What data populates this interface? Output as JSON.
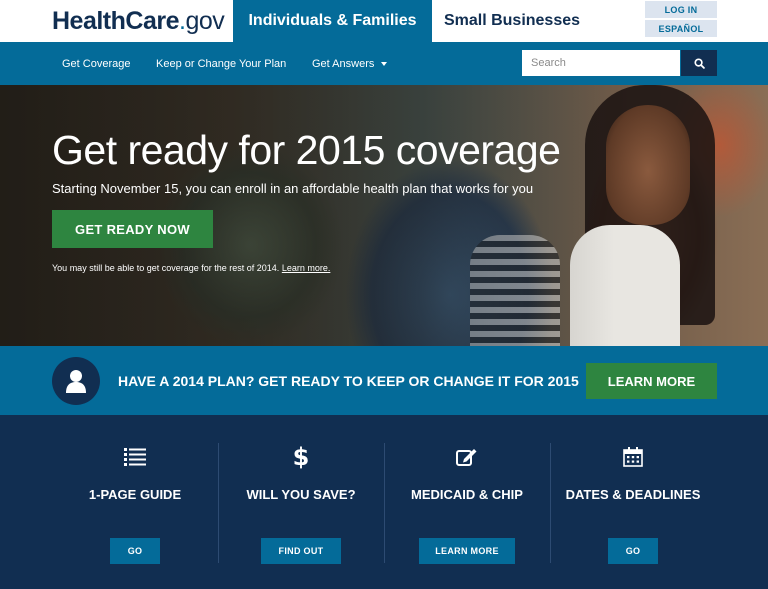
{
  "header": {
    "logo_health": "HealthCare",
    "logo_dot": ".",
    "logo_gov": "gov",
    "tab_individuals": "Individuals & Families",
    "tab_small_business": "Small Businesses",
    "login_label": "LOG IN",
    "espanol_label": "ESPAÑOL"
  },
  "nav": {
    "items": [
      {
        "label": "Get Coverage"
      },
      {
        "label": "Keep or Change Your Plan"
      },
      {
        "label": "Get Answers"
      }
    ],
    "search_placeholder": "Search"
  },
  "hero": {
    "title": "Get ready for 2015 coverage",
    "subtitle": "Starting November 15, you can enroll in an affordable health plan that works for you",
    "cta_label": "GET READY NOW",
    "note_text": "You may still be able to get coverage for the rest of 2014.",
    "note_link": "Learn more."
  },
  "banner": {
    "text": "HAVE A 2014 PLAN? GET READY TO KEEP OR CHANGE IT FOR 2015",
    "button_label": "LEARN MORE"
  },
  "features": [
    {
      "icon": "list-icon",
      "title": "1-PAGE GUIDE",
      "button": "GO"
    },
    {
      "icon": "dollar-icon",
      "title": "WILL YOU SAVE?",
      "button": "FIND OUT"
    },
    {
      "icon": "edit-icon",
      "title": "MEDICAID & CHIP",
      "button": "LEARN MORE"
    },
    {
      "icon": "calendar-icon",
      "title": "DATES & DEADLINES",
      "button": "GO"
    }
  ],
  "colors": {
    "navy": "#112e51",
    "blue": "#046b99",
    "green": "#2e8540",
    "light": "#dce4ef"
  }
}
